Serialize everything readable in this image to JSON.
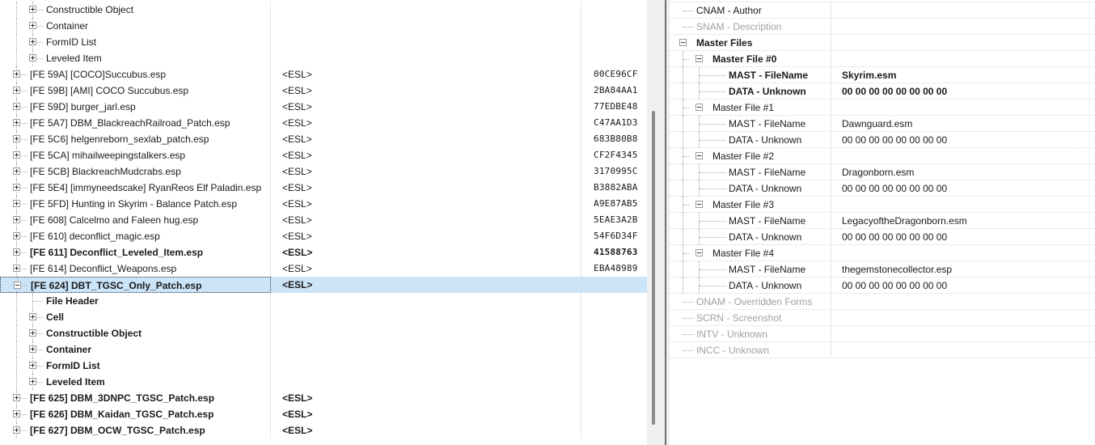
{
  "left_tree": {
    "rows": [
      {
        "name": "Constructible Object",
        "esl": "",
        "hash": "",
        "level": 1,
        "expander": "plus",
        "bold": false,
        "selected": false
      },
      {
        "name": "Container",
        "esl": "",
        "hash": "",
        "level": 1,
        "expander": "plus",
        "bold": false,
        "selected": false
      },
      {
        "name": "FormID List",
        "esl": "",
        "hash": "",
        "level": 1,
        "expander": "plus",
        "bold": false,
        "selected": false
      },
      {
        "name": "Leveled Item",
        "esl": "",
        "hash": "",
        "level": 1,
        "expander": "plus",
        "bold": false,
        "selected": false
      },
      {
        "name": "[FE 59A] [COCO]Succubus.esp",
        "esl": "<ESL>",
        "hash": "00CE96CF",
        "level": 0,
        "expander": "plus",
        "bold": false,
        "selected": false
      },
      {
        "name": "[FE 59B] [AMI] COCO Succubus.esp",
        "esl": "<ESL>",
        "hash": "2BA84AA1",
        "level": 0,
        "expander": "plus",
        "bold": false,
        "selected": false
      },
      {
        "name": "[FE 59D] burger_jarl.esp",
        "esl": "<ESL>",
        "hash": "77EDBE48",
        "level": 0,
        "expander": "plus",
        "bold": false,
        "selected": false
      },
      {
        "name": "[FE 5A7] DBM_BlackreachRailroad_Patch.esp",
        "esl": "<ESL>",
        "hash": "C47AA1D3",
        "level": 0,
        "expander": "plus",
        "bold": false,
        "selected": false
      },
      {
        "name": "[FE 5C6] helgenreborn_sexlab_patch.esp",
        "esl": "<ESL>",
        "hash": "683B80B8",
        "level": 0,
        "expander": "plus",
        "bold": false,
        "selected": false
      },
      {
        "name": "[FE 5CA] mihailweepingstalkers.esp",
        "esl": "<ESL>",
        "hash": "CF2F4345",
        "level": 0,
        "expander": "plus",
        "bold": false,
        "selected": false
      },
      {
        "name": "[FE 5CB] BlackreachMudcrabs.esp",
        "esl": "<ESL>",
        "hash": "3170995C",
        "level": 0,
        "expander": "plus",
        "bold": false,
        "selected": false
      },
      {
        "name": "[FE 5E4] [immyneedscake] RyanReos Elf Paladin.esp",
        "esl": "<ESL>",
        "hash": "B3882ABA",
        "level": 0,
        "expander": "plus",
        "bold": false,
        "selected": false
      },
      {
        "name": "[FE 5FD] Hunting in Skyrim - Balance Patch.esp",
        "esl": "<ESL>",
        "hash": "A9E87AB5",
        "level": 0,
        "expander": "plus",
        "bold": false,
        "selected": false
      },
      {
        "name": "[FE 608] Calcelmo and Faleen hug.esp",
        "esl": "<ESL>",
        "hash": "5EAE3A2B",
        "level": 0,
        "expander": "plus",
        "bold": false,
        "selected": false
      },
      {
        "name": "[FE 610] deconflict_magic.esp",
        "esl": "<ESL>",
        "hash": "54F6D34F",
        "level": 0,
        "expander": "plus",
        "bold": false,
        "selected": false
      },
      {
        "name": "[FE 611] Deconflict_Leveled_Item.esp",
        "esl": "<ESL>",
        "hash": "41588763",
        "level": 0,
        "expander": "plus",
        "bold": true,
        "selected": false
      },
      {
        "name": "[FE 614] Deconflict_Weapons.esp",
        "esl": "<ESL>",
        "hash": "EBA48989",
        "level": 0,
        "expander": "plus",
        "bold": false,
        "selected": false
      },
      {
        "name": "[FE 624] DBT_TGSC_Only_Patch.esp",
        "esl": "<ESL>",
        "hash": "",
        "level": 0,
        "expander": "minus",
        "bold": true,
        "selected": true
      },
      {
        "name": "File Header",
        "esl": "",
        "hash": "",
        "level": 1,
        "expander": "none",
        "bold": true,
        "selected": false
      },
      {
        "name": "Cell",
        "esl": "",
        "hash": "",
        "level": 1,
        "expander": "plus",
        "bold": true,
        "selected": false
      },
      {
        "name": "Constructible Object",
        "esl": "",
        "hash": "",
        "level": 1,
        "expander": "plus",
        "bold": true,
        "selected": false
      },
      {
        "name": "Container",
        "esl": "",
        "hash": "",
        "level": 1,
        "expander": "plus",
        "bold": true,
        "selected": false
      },
      {
        "name": "FormID List",
        "esl": "",
        "hash": "",
        "level": 1,
        "expander": "plus",
        "bold": true,
        "selected": false
      },
      {
        "name": "Leveled Item",
        "esl": "",
        "hash": "",
        "level": 1,
        "expander": "plus",
        "bold": true,
        "selected": false
      },
      {
        "name": "[FE 625] DBM_3DNPC_TGSC_Patch.esp",
        "esl": "<ESL>",
        "hash": "",
        "level": 0,
        "expander": "plus",
        "bold": true,
        "selected": false
      },
      {
        "name": "[FE 626] DBM_Kaidan_TGSC_Patch.esp",
        "esl": "<ESL>",
        "hash": "",
        "level": 0,
        "expander": "plus",
        "bold": true,
        "selected": false
      },
      {
        "name": "[FE 627] DBM_OCW_TGSC_Patch.esp",
        "esl": "<ESL>",
        "hash": "",
        "level": 0,
        "expander": "plus",
        "bold": true,
        "selected": false
      }
    ]
  },
  "right_view": {
    "rows": [
      {
        "key": "CNAM - Author",
        "value": "",
        "level": 0,
        "expander": "none",
        "bold": false,
        "dim": false
      },
      {
        "key": "SNAM - Description",
        "value": "",
        "level": 0,
        "expander": "none",
        "bold": false,
        "dim": true
      },
      {
        "key": "Master Files",
        "value": "",
        "level": 0,
        "expander": "minus",
        "bold": true,
        "dim": false
      },
      {
        "key": "Master File #0",
        "value": "",
        "level": 1,
        "expander": "minus",
        "bold": true,
        "dim": false
      },
      {
        "key": "MAST - FileName",
        "value": "Skyrim.esm",
        "level": 2,
        "expander": "none",
        "bold": true,
        "dim": false
      },
      {
        "key": "DATA - Unknown",
        "value": "00 00 00 00 00 00 00 00",
        "level": 2,
        "expander": "none",
        "bold": true,
        "dim": false
      },
      {
        "key": "Master File #1",
        "value": "",
        "level": 1,
        "expander": "minus",
        "bold": false,
        "dim": false
      },
      {
        "key": "MAST - FileName",
        "value": "Dawnguard.esm",
        "level": 2,
        "expander": "none",
        "bold": false,
        "dim": false
      },
      {
        "key": "DATA - Unknown",
        "value": "00 00 00 00 00 00 00 00",
        "level": 2,
        "expander": "none",
        "bold": false,
        "dim": false
      },
      {
        "key": "Master File #2",
        "value": "",
        "level": 1,
        "expander": "minus",
        "bold": false,
        "dim": false
      },
      {
        "key": "MAST - FileName",
        "value": "Dragonborn.esm",
        "level": 2,
        "expander": "none",
        "bold": false,
        "dim": false
      },
      {
        "key": "DATA - Unknown",
        "value": "00 00 00 00 00 00 00 00",
        "level": 2,
        "expander": "none",
        "bold": false,
        "dim": false
      },
      {
        "key": "Master File #3",
        "value": "",
        "level": 1,
        "expander": "minus",
        "bold": false,
        "dim": false
      },
      {
        "key": "MAST - FileName",
        "value": "LegacyoftheDragonborn.esm",
        "level": 2,
        "expander": "none",
        "bold": false,
        "dim": false
      },
      {
        "key": "DATA - Unknown",
        "value": "00 00 00 00 00 00 00 00",
        "level": 2,
        "expander": "none",
        "bold": false,
        "dim": false
      },
      {
        "key": "Master File #4",
        "value": "",
        "level": 1,
        "expander": "minus",
        "bold": false,
        "dim": false
      },
      {
        "key": "MAST - FileName",
        "value": "thegemstonecollector.esp",
        "level": 2,
        "expander": "none",
        "bold": false,
        "dim": false
      },
      {
        "key": "DATA - Unknown",
        "value": "00 00 00 00 00 00 00 00",
        "level": 2,
        "expander": "none",
        "bold": false,
        "dim": false
      },
      {
        "key": "ONAM - Overridden Forms",
        "value": "",
        "level": 0,
        "expander": "none",
        "bold": false,
        "dim": true
      },
      {
        "key": "SCRN - Screenshot",
        "value": "",
        "level": 0,
        "expander": "none",
        "bold": false,
        "dim": true
      },
      {
        "key": "INTV - Unknown",
        "value": "",
        "level": 0,
        "expander": "none",
        "bold": false,
        "dim": true
      },
      {
        "key": "INCC - Unknown",
        "value": "",
        "level": 0,
        "expander": "none",
        "bold": false,
        "dim": true
      }
    ]
  },
  "colors": {
    "selection": "#cce4f7",
    "dim_text": "#a0a0a0",
    "tree_lines": "#a8a8a8"
  },
  "icons": {
    "collapsed": "plus-box-icon",
    "expanded": "minus-box-icon"
  }
}
